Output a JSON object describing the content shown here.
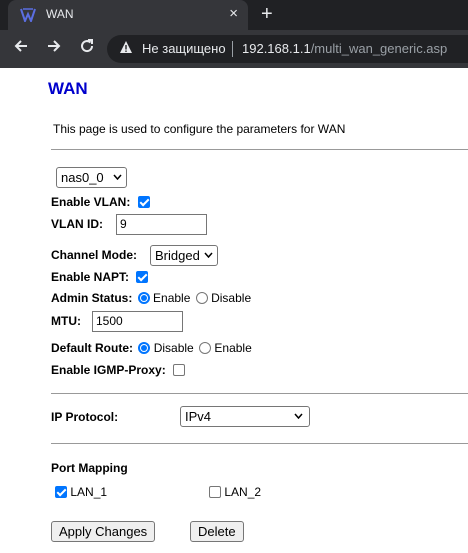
{
  "browser": {
    "tab_title": "WAN",
    "tab_close": "×",
    "new_tab": "+",
    "not_secure": "Не защищено",
    "url_host": "192.168.1.1",
    "url_path": "/multi_wan_generic.asp"
  },
  "page": {
    "title": "WAN",
    "description": "This page is used to configure the parameters for WAN"
  },
  "form": {
    "interface_select": "nas0_0",
    "enable_vlan_label": "Enable VLAN:",
    "enable_vlan_checked": true,
    "vlan_id_label": "VLAN ID:",
    "vlan_id_value": "9",
    "channel_mode_label": "Channel Mode:",
    "channel_mode_value": "Bridged",
    "enable_napt_label": "Enable NAPT:",
    "enable_napt_checked": true,
    "admin_status_label": "Admin Status:",
    "admin_status_enable": "Enable",
    "admin_status_disable": "Disable",
    "admin_status_selected": "Enable",
    "mtu_label": "MTU:",
    "mtu_value": "1500",
    "default_route_label": "Default Route:",
    "default_route_disable": "Disable",
    "default_route_enable": "Enable",
    "default_route_selected": "Disable",
    "igmp_label": "Enable IGMP-Proxy:",
    "igmp_checked": false,
    "ip_protocol_label": "IP Protocol:",
    "ip_protocol_value": "IPv4",
    "port_mapping_label": "Port Mapping",
    "lan1_label": "LAN_1",
    "lan1_checked": true,
    "lan2_label": "LAN_2",
    "lan2_checked": false,
    "apply_button": "Apply Changes",
    "delete_button": "Delete"
  },
  "colors": {
    "title": "#0000cc",
    "accent": "#0075ff",
    "chrome_dark": "#202124",
    "chrome_tab": "#35363a"
  },
  "icons": {
    "favicon": "router-favicon-icon",
    "back": "back-arrow-icon",
    "forward": "forward-arrow-icon",
    "reload": "reload-icon",
    "warning": "warning-icon"
  }
}
